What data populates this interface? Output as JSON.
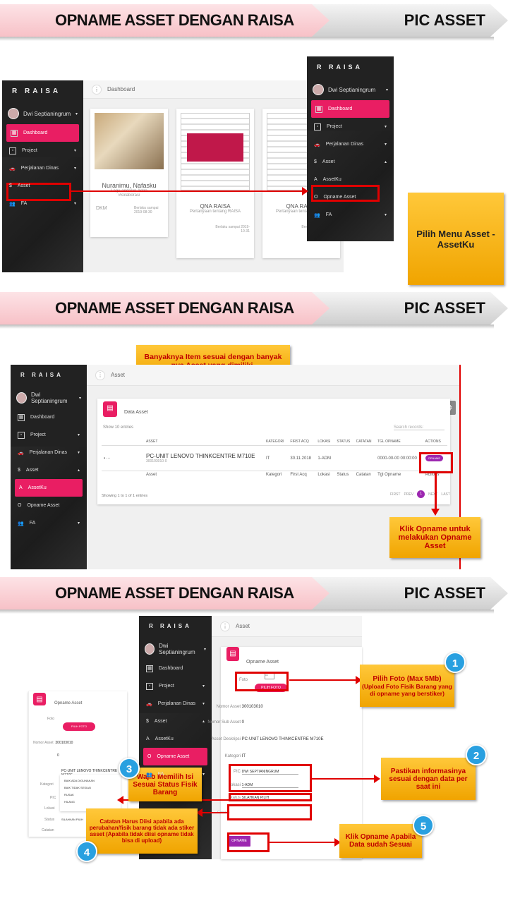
{
  "banner": {
    "title": "OPNAME ASSET DENGAN RAISA",
    "right": "PIC ASSET"
  },
  "app": {
    "brand": "R  RAISA",
    "user": "Dwi Septianingrum"
  },
  "menu": {
    "dashboard": "Dashboard",
    "project": "Project",
    "perjalanan": "Perjalanan Dinas",
    "asset": "Asset",
    "assetku": "AssetKu",
    "opname_asset": "Opname Asset",
    "fa": "FA"
  },
  "section1": {
    "breadcrumb": "Dashboard",
    "card1_title": "Nuranimu, Nafasku",
    "card1_sub": "Lagu andalan Astra",
    "card1_sub2": "#kolaborasi",
    "card1_foot": "DKM",
    "card1_date": "Berlaku sampai 2019-08-30",
    "card2_title": "QNA RAISA",
    "card2_sub": "Pertanyaan tentang RAISA",
    "card2_foot": "Berlaku sampai 2019-10-31",
    "card3_title": "QNA RAISA",
    "card3_sub": "Pertanyaan tentang RAISA",
    "card3_foot": "Berlaku sampai 2019-10-31",
    "callout": "Pilih Menu Asset - AssetKu"
  },
  "section2": {
    "callout_top": "Banyaknya Item sesuai dengan banyak nya Asset yang dimiliki.",
    "breadcrumb": "Asset",
    "card_title": "Data Asset",
    "show": "Show 10 entries",
    "search": "Search records:",
    "headers": [
      "ASSET",
      "KATEGORI",
      "FIRST ACQ",
      "LOKASI",
      "STATUS",
      "CATATAN",
      "TGL OPNAME",
      "ACTIONS"
    ],
    "row": {
      "asset": "PC-UNIT LENOVO THINKCENTRE M710E",
      "code": "300103010-0",
      "kategori": "IT",
      "acq": "30.11.2018",
      "lokasi": "1-ADM",
      "tgl": "0000-00-00 00:00:00",
      "action": "OPNAME"
    },
    "footers": [
      "Asset",
      "Kategori",
      "First Acq",
      "Lokasi",
      "Status",
      "Catatan",
      "Tgl Opname",
      "Actions"
    ],
    "showing": "Showing 1 to 1 of 1 entries",
    "pager": [
      "FIRST",
      "PREV",
      "1",
      "NEXT",
      "LAST"
    ],
    "callout": "Klik Opname untuk melakukan Opname Asset"
  },
  "section3": {
    "breadcrumb": "Asset",
    "card_title": "Opname Asset",
    "foto": "Foto",
    "pilih_foto": "PILIH FOTO",
    "nomor_asset_label": "Nomor Asset",
    "nomor_asset": "300103010",
    "nomor_sub_label": "Nomor Sub Asset",
    "nomor_sub": "0",
    "deskripsi_label": "Asset Deskripsi",
    "deskripsi": "PC-UNIT LENOVO THINKCENTRE M710E",
    "kategori_label": "Kategori",
    "kategori": "IT",
    "pic_label": "PIC",
    "pic": "DWI SEPTIANINGRUM",
    "lokasi_label": "Lokasi",
    "lokasi": "1-ADM",
    "status_label": "Status",
    "status": "SILAHKAN PILIH",
    "catatan_label": "Catatan",
    "opname_btn": "OPNAME",
    "dropdown": [
      "BAIK ADA DIGUNAKAN",
      "BAIK TIDAK SESUAI",
      "RUSAK",
      "HILANG"
    ],
    "status_small": "SILAHKAN PILIH",
    "c1": "Pilih Foto (Max 5Mb)",
    "c1b": "(Upload Foto Fisik Barang yang di opname yang berstiker)",
    "c2": "Pastikan informasinya sesuai dengan data per saat ini",
    "c3": "Wajib Memilih Isi Sesuai Status Fisik Barang",
    "c4": "Catatan Harus Diisi apabila ada perubahan/fisik barang tidak ada stiker asset (Apabila tidak diisi opname tidak bisa di upload)",
    "c5": "Klik Opname Apabila Data sudah Sesuai",
    "n1": "1",
    "n2": "2",
    "n3": "3",
    "n4": "4",
    "n5": "5"
  }
}
